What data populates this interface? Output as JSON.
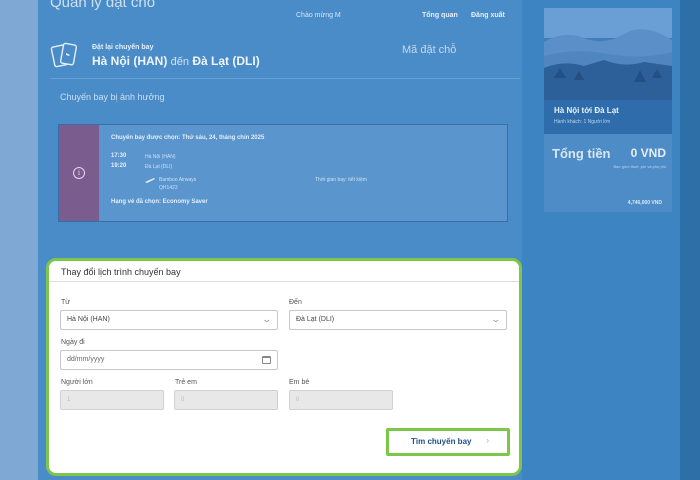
{
  "page": {
    "title": "Quản lý đặt chỗ",
    "links": {
      "user": "Chào mừng M",
      "overview": "Tổng quan",
      "logout": "Đăng xuất"
    }
  },
  "booking": {
    "label": "Đặt lại chuyến bay",
    "route_from": "Hà Nội (HAN)",
    "route_connector": "đến",
    "route_to": "Đà Lạt (DLI)",
    "booking_code_label": "Mã đặt chỗ",
    "section_label": "Chuyến bay bị ảnh hưởng"
  },
  "flight_card": {
    "title": "Chuyến bay được chọn: Thứ sáu, 24, tháng chín 2025",
    "depart_time": "17:30",
    "arrive_time": "19:20",
    "depart_place": "Hà Nội (HAN)",
    "arrive_place": "Đà Lạt (DLI)",
    "airline": "Bamboo Airways",
    "flight_no": "QH1423",
    "duration_label": "Thời gian bay: tiết kiệm",
    "fare_class": "Hạng vé đã chọn: Economy Saver"
  },
  "side": {
    "destination": "Hà Nội tới Đà Lạt",
    "destination_sub": "Hành khách: 1 Người lớn",
    "total_label": "Tổng tiền",
    "total_value": "0 VND",
    "total_note": "Bao gồm thuế, phí và phụ phí",
    "total_price": "4,746,000 VND"
  },
  "form": {
    "title": "Thay đổi lịch trình chuyến bay",
    "from_label": "Từ",
    "from_value": "Hà Nội (HAN)",
    "to_label": "Đến",
    "to_value": "Đà Lạt (DLI)",
    "date_label": "Ngày đi",
    "date_placeholder": "dd/mm/yyyy",
    "adults_label": "Người lớn",
    "adults_value": "1",
    "children_label": "Trẻ em",
    "children_value": "0",
    "infants_label": "Em bé",
    "infants_value": "0",
    "search_button": "Tìm chuyến bay"
  },
  "colors": {
    "highlight": "#7ec64a",
    "overlay": "#4a8cc8",
    "button_text": "#1d4f8a"
  },
  "icons": [
    "ticket-icon",
    "info-icon",
    "plane-icon",
    "chevron-down-icon",
    "calendar-icon",
    "chevron-right-icon"
  ]
}
